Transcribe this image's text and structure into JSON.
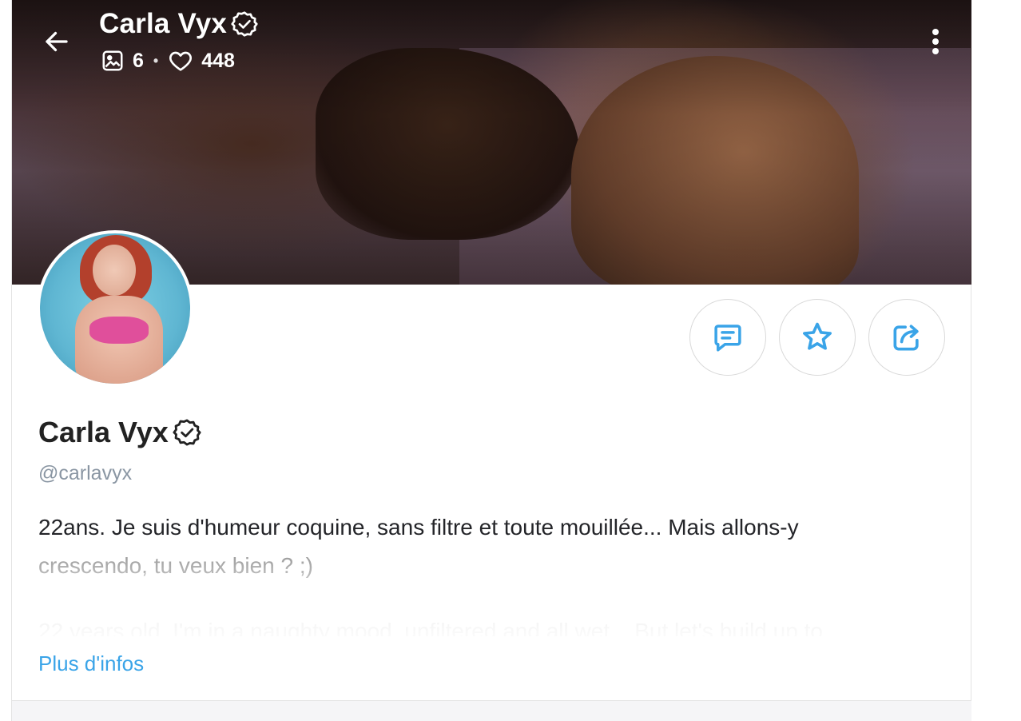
{
  "header": {
    "title": "Carla Vyx",
    "photos_count": "6",
    "likes_count": "448",
    "separator": "•"
  },
  "profile": {
    "display_name": "Carla Vyx",
    "username": "@carlavyx",
    "bio_line1": "22ans. Je suis d'humeur coquine, sans filtre et toute mouillée... Mais allons-y",
    "bio_line2": "crescendo, tu veux bien ? ;)",
    "bio_line3": "22 years old. I'm in a naughty mood, unfiltered and all wet... But let's build up to",
    "more_info_label": "Plus d'infos"
  },
  "icons": {
    "back": "arrow-left-icon",
    "photos": "image-icon",
    "likes": "heart-icon",
    "verified": "verified-badge-icon",
    "more": "more-vertical-icon",
    "message": "message-icon",
    "favorite": "star-icon",
    "share": "share-icon"
  },
  "colors": {
    "accent": "#3aa4e8",
    "text": "#242529",
    "muted": "#8a96a3"
  }
}
